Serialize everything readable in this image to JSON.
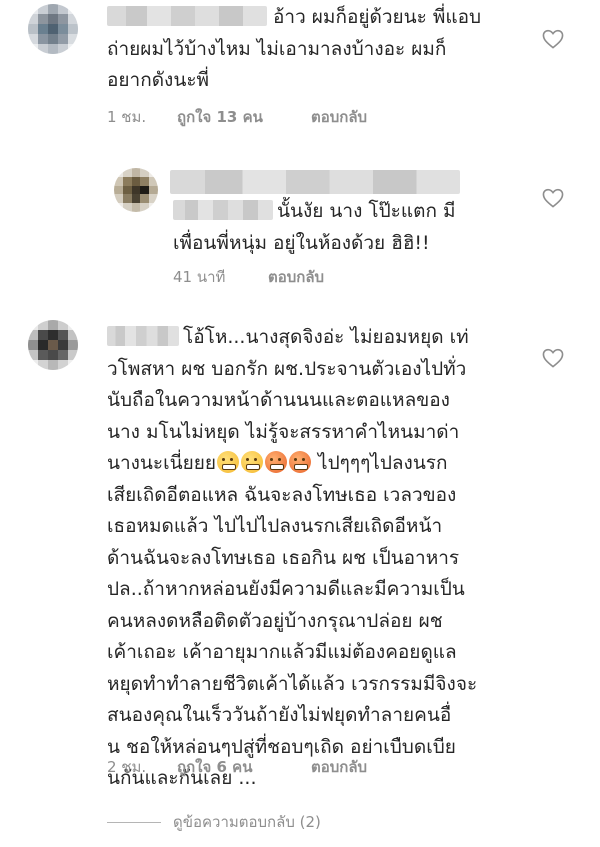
{
  "comments": [
    {
      "text": "อ้าว ผมก็อยู่ด้วยนะ พี่แอบ\nถ่ายผมไว้บ้างไหม ไม่เอามาลงบ้างอะ ผมก็\nอยากดังนะพี่",
      "time": "1 ชม.",
      "likes": "ถูกใจ 13 คน",
      "reply_label": "ตอบกลับ"
    },
    {
      "text": "นั้นงัย นาง โป๊ะแตก มี\nเพื่อนพี่หนุ่ม อยู่ในห้องด้วย ฮิฮิ!!",
      "time": "41 นาที",
      "reply_label": "ตอบกลับ"
    },
    {
      "text_lines_before_emoji": "โอ้โห...นางสุดจิงอ่ะ ไม่ยอมหยุด เท่\nวโพสหา ผช บอกรัก ผช.ประจานตัวเองไปทั่ว\nนับถือในความหน้าด้านนนและตอแหลของ\nนาง มโนไม่หยุด ไม่รู้จะสรรหาคำไหนมาด่า\nนางนะเนี่ยยย",
      "text_after_emoji": " ไปๆๆๆไปลงนรก\nเสียเถิดอีตอแหล ฉันจะลงโทษเธอ เวลวของ\nเธอหมดแล้ว ไปไปไปลงนรกเสียเถิดอีหน้า\nด้านฉันจะลงโทษเธอ เธอกิน ผช เป็นอาหาร\nปล..ถ้าหากหล่อนยังมีความดีและมีความเป็น\nคนหลงดหลือติดตัวอยู่บ้างกรุณาปล่อย ผช\nเค้าเถอะ เค้าอายุมากแล้วมีแม่ต้องคอยดูแล\nหยุดทำทำลายชีวิตเค้าได้แล้ว เวรกรรมมีจิงจะ\nสนองคุณในเร็ววันถ้ายังไม่ฟยุดทำลายคนอื่\nน ชอให้หล่อนๆปสู่ที่ชอบๆเถิด อย่าเบืบดเบีย\nนกันและกันเลย ...",
      "emojis": [
        "angry-yellow-emoji",
        "angry-yellow-emoji",
        "angry-red-emoji",
        "angry-red-emoji"
      ],
      "time": "2 ชม.",
      "likes": "ถูกใจ 6 คน",
      "reply_label": "ตอบกลับ"
    }
  ],
  "view_replies_label": "ดูข้อความตอบกลับ (2)",
  "colors": {
    "text": "#262626",
    "meta": "#8e8e8e",
    "heart": "#8e8e8e"
  }
}
